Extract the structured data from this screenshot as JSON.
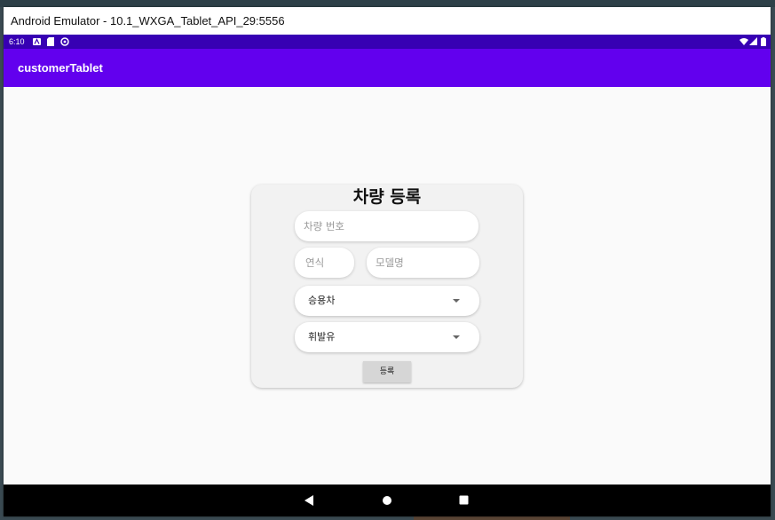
{
  "window": {
    "title": "Android Emulator - 10.1_WXGA_Tablet_API_29:5556"
  },
  "statusbar": {
    "time": "6:10"
  },
  "appbar": {
    "title": "customerTablet"
  },
  "form": {
    "title": "차량 등록",
    "plate_placeholder": "차량 번호",
    "year_placeholder": "연식",
    "model_placeholder": "모델명",
    "car_type_selected": "승용차",
    "fuel_type_selected": "휘발유",
    "register_label": "등록"
  },
  "colors": {
    "status_bar": "#3700b3",
    "app_bar": "#6200ee",
    "background": "#fafafa",
    "card": "#f2f2f2",
    "button": "#d6d6d6",
    "nav_bar": "#000000"
  },
  "icons": {
    "status_left": [
      "a-notification-icon",
      "sd-card-icon",
      "sync-icon"
    ],
    "status_right": [
      "wifi-icon",
      "signal-icon",
      "battery-icon"
    ],
    "nav": [
      "back-icon",
      "home-icon",
      "recents-icon"
    ]
  }
}
